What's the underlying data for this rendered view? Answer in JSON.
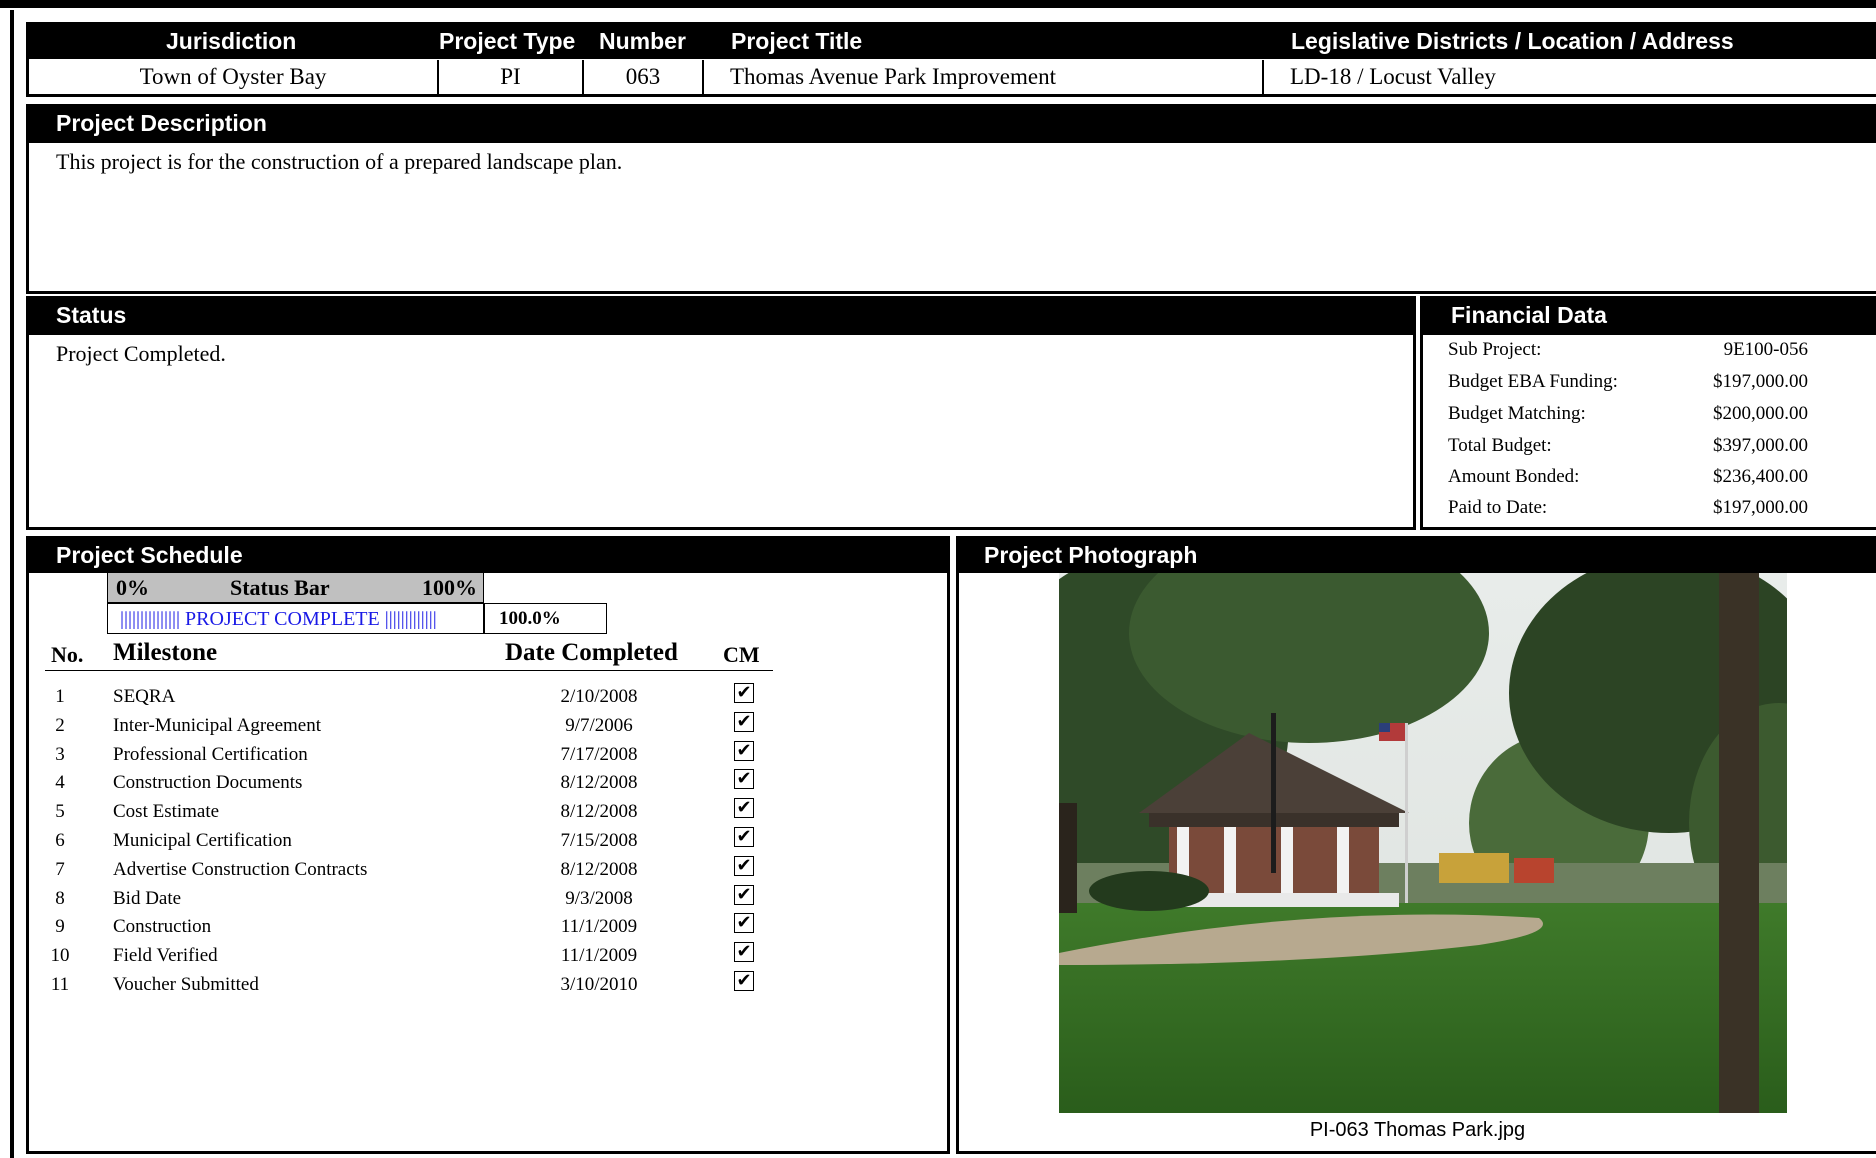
{
  "header_table": {
    "col_jurisdiction": "Jurisdiction",
    "col_project_type": "Project Type",
    "col_number": "Number",
    "col_title": "Project Title",
    "col_location": "Legislative Districts / Location / Address",
    "jurisdiction": "Town of Oyster Bay",
    "project_type": "PI",
    "number": "063",
    "title": "Thomas Avenue Park Improvement",
    "location": "LD-18 /  Locust Valley"
  },
  "description": {
    "heading": "Project Description",
    "text": "This project is for the construction of a prepared landscape plan."
  },
  "status": {
    "heading": "Status",
    "text": "Project Completed."
  },
  "financial": {
    "heading": "Financial Data",
    "rows": [
      {
        "label": "Sub Project:",
        "value": "9E100-056"
      },
      {
        "label": "Budget EBA Funding:",
        "value": "$197,000.00"
      },
      {
        "label": "Budget Matching:",
        "value": "$200,000.00"
      },
      {
        "label": "Total Budget:",
        "value": "$397,000.00"
      },
      {
        "label": "Amount Bonded:",
        "value": "$236,400.00"
      },
      {
        "label": "Paid to Date:",
        "value": "$197,000.00"
      }
    ]
  },
  "schedule": {
    "heading": "Project Schedule",
    "status_bar": {
      "min_label": "0%",
      "title": "Status Bar",
      "max_label": "100%",
      "fill_text": "||||||||||||||| PROJECT COMPLETE |||||||||||||",
      "progress_fraction": 1.0,
      "percent_text": "100.0%"
    },
    "col_no": "No.",
    "col_milestone": "Milestone",
    "col_date": "Date Completed",
    "col_cm": "CM",
    "checkmark_glyph": "✔",
    "milestones": [
      {
        "no": "1",
        "name": "SEQRA",
        "date": "2/10/2008",
        "cm": true
      },
      {
        "no": "2",
        "name": "Inter-Municipal Agreement",
        "date": "9/7/2006",
        "cm": true
      },
      {
        "no": "3",
        "name": "Professional Certification",
        "date": "7/17/2008",
        "cm": true
      },
      {
        "no": "4",
        "name": "Construction Documents",
        "date": "8/12/2008",
        "cm": true
      },
      {
        "no": "5",
        "name": "Cost Estimate",
        "date": "8/12/2008",
        "cm": true
      },
      {
        "no": "6",
        "name": "Municipal Certification",
        "date": "7/15/2008",
        "cm": true
      },
      {
        "no": "7",
        "name": "Advertise Construction Contracts",
        "date": "8/12/2008",
        "cm": true
      },
      {
        "no": "8",
        "name": "Bid Date",
        "date": "9/3/2008",
        "cm": true
      },
      {
        "no": "9",
        "name": "Construction",
        "date": "11/1/2009",
        "cm": true
      },
      {
        "no": "10",
        "name": "Field Verified",
        "date": "11/1/2009",
        "cm": true
      },
      {
        "no": "11",
        "name": "Voucher Submitted",
        "date": "3/10/2010",
        "cm": true
      }
    ]
  },
  "photograph": {
    "heading": "Project Photograph",
    "caption": "PI-063 Thomas Park.jpg"
  }
}
